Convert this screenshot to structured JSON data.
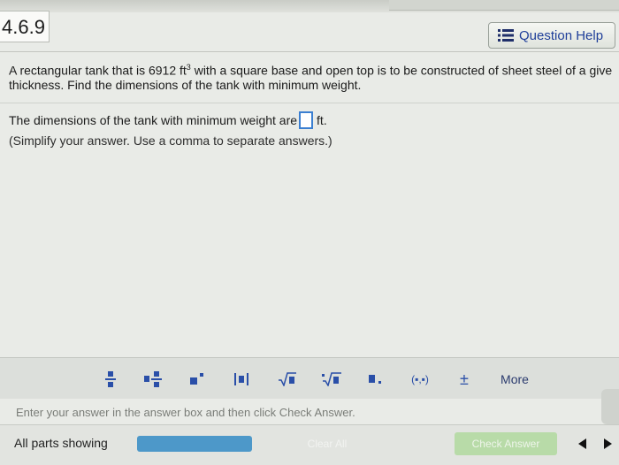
{
  "question_number": "4.6.9",
  "help_button": {
    "label": "Question Help",
    "icon": "menu-icon"
  },
  "problem": {
    "line1_prefix": "A rectangular tank that is 6912 ft",
    "line1_sup": "3",
    "line1_suffix": " with a square base and open top is to be constructed of sheet steel of a give",
    "line2": "thickness. Find the dimensions of the tank with minimum weight."
  },
  "answer": {
    "prompt": "The dimensions of the tank with minimum weight are",
    "value": "",
    "unit": "ft.",
    "hint": "(Simplify your answer. Use a comma to separate answers.)"
  },
  "palette": {
    "buttons": [
      {
        "name": "fraction-button",
        "glyph": "▪/▪"
      },
      {
        "name": "mixed-number-button",
        "glyph": "▪▪/▪"
      },
      {
        "name": "exponent-button",
        "glyph": "▪ˣ"
      },
      {
        "name": "absolute-value-button",
        "glyph": "|▪|"
      },
      {
        "name": "sqrt-button",
        "glyph": "√▪"
      },
      {
        "name": "nth-root-button",
        "glyph": "ⁿ√▪"
      },
      {
        "name": "decimal-button",
        "glyph": "▪."
      },
      {
        "name": "ordered-pair-button",
        "glyph": "(▪,▪)"
      },
      {
        "name": "plus-minus-button",
        "glyph": "±"
      }
    ],
    "more_label": "More"
  },
  "status_text": "Enter your answer in the answer box and then click Check Answer.",
  "footer": {
    "parts_label": "All parts showing",
    "progress": 1.0,
    "clear_all_label": "Clear All",
    "check_answer_label": "Check Answer"
  },
  "colors": {
    "accent_blue": "#2a4fa8",
    "answer_box_border": "#3b7fd1",
    "progress_fill": "#4d98c9",
    "check_button_bg": "#b8dba8"
  }
}
